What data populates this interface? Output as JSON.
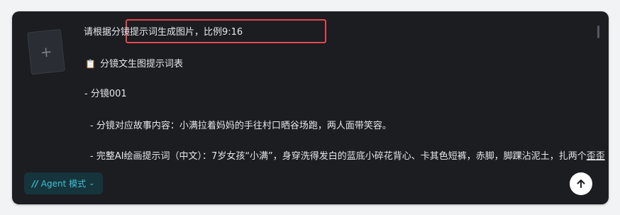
{
  "composer": {
    "attachment_placeholder": "+",
    "lines": [
      "请根据分镜提示词生成图片，比例9:16",
      "分镜文生图提示词表",
      "- 分镜001",
      "- 分镜对应故事内容：小满拉着妈妈的手往村口晒谷场跑，两人面带笑容。",
      "- 完整AI绘画提示词（中文）：7岁女孩“小满”，身穿洗得发白的蓝底小碎花背心、卡其色短裤，赤脚，脚踝沾泥土，扎两个",
      "歪歪"
    ],
    "clip_icon": "clipboard-icon"
  },
  "toolbar": {
    "agent_mode_label": "Agent 模式",
    "agent_icon": "agent-slash-icon",
    "chevron": "chevron-down-icon",
    "send_icon": "arrow-up-icon"
  },
  "colors": {
    "panel_bg": "#1b1d21",
    "text": "#e6e8ec",
    "highlight_border": "#e5484d",
    "agent_accent": "#3fc1d4"
  }
}
